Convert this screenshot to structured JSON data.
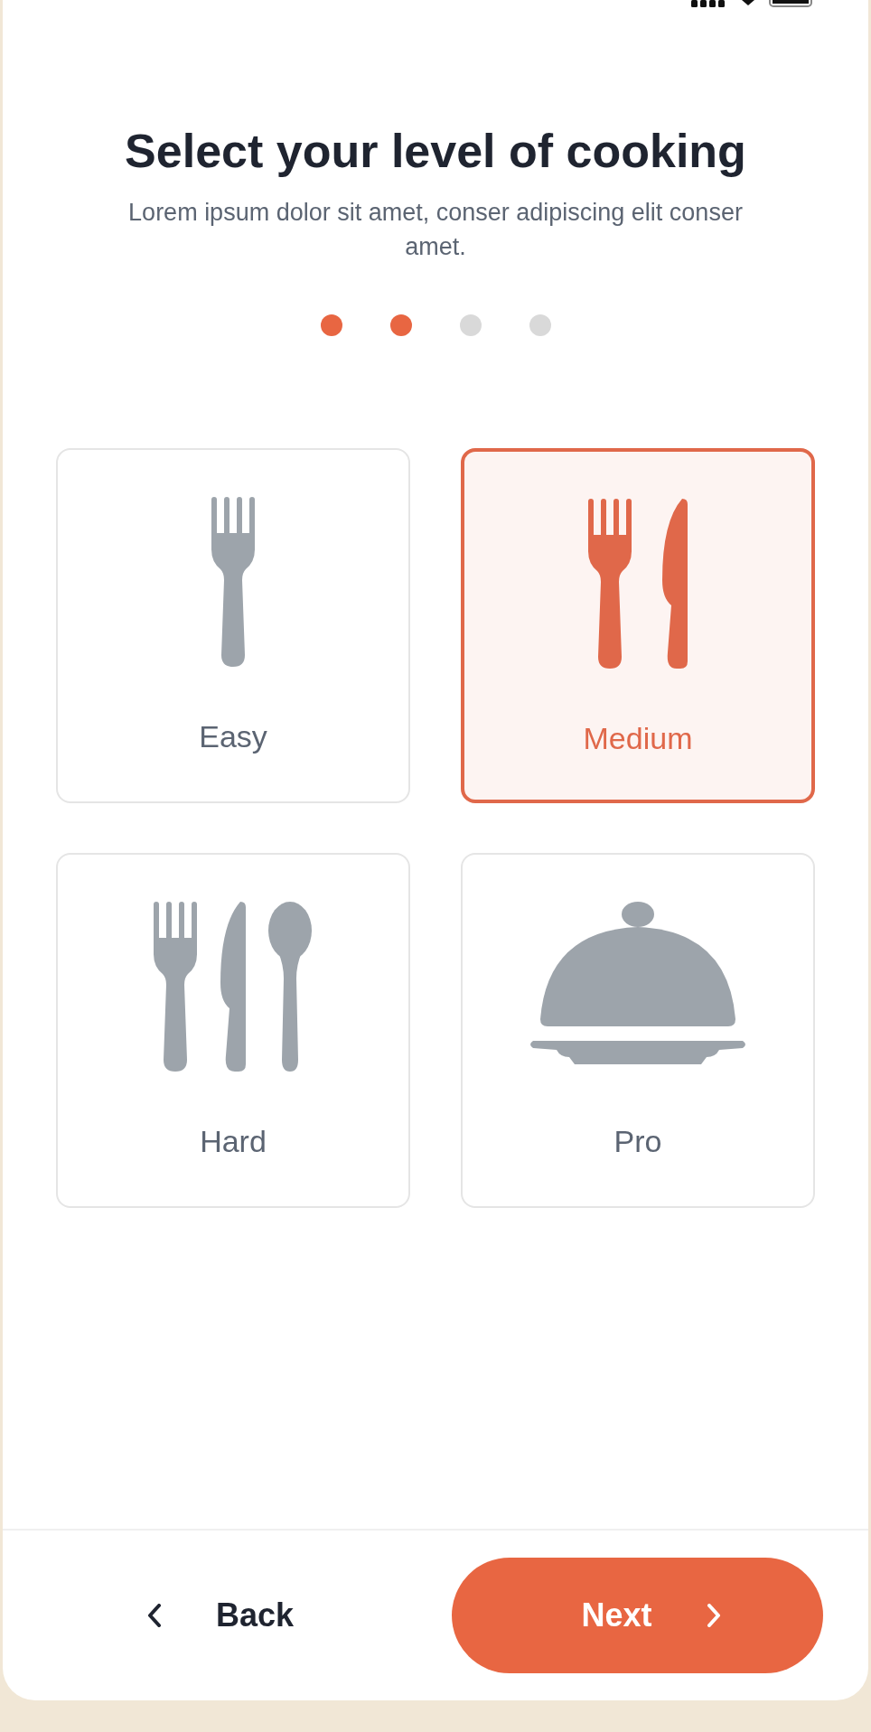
{
  "title": "Select your level of cooking",
  "subtitle": "Lorem ipsum dolor sit amet, conser adipiscing elit conser amet.",
  "steps": [
    {
      "done": true
    },
    {
      "done": true
    },
    {
      "done": false
    },
    {
      "done": false
    }
  ],
  "levels": [
    {
      "label": "Easy",
      "kind": "fork",
      "selected": false
    },
    {
      "label": "Medium",
      "kind": "fork-knife",
      "selected": true
    },
    {
      "label": "Hard",
      "kind": "cutlery",
      "selected": false
    },
    {
      "label": "Pro",
      "kind": "cloche",
      "selected": false
    }
  ],
  "back": {
    "label": "Back"
  },
  "next": {
    "label": "Next"
  }
}
